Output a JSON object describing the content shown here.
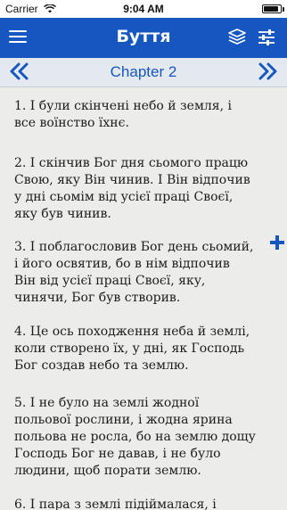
{
  "status_bar": {
    "carrier": "Carrier",
    "time": "9:04 AM",
    "battery_level": 0.9
  },
  "nav_bar": {
    "title": "Буття",
    "menu_icon": "menu-icon",
    "book_icon": "book-icon",
    "settings_icon": "sliders-icon"
  },
  "chapter_bar": {
    "label": "Chapter 2",
    "prev_icon": "double-chevron-left-icon",
    "next_icon": "double-chevron-right-icon"
  },
  "verses": [
    {
      "lines": [
        "1.  І були скінчені небо й земля, і",
        "все воїнство їхнє."
      ]
    },
    {
      "lines": [
        "2.  І скінчив Бог дня сьомого працю",
        "Свою, яку Він чинив. І Він відпочив",
        "у дні сьомім від усієї праці Своєї,",
        "яку був чинив."
      ]
    },
    {
      "lines": [
        "3.  І поблагословив Бог день сьомий,",
        "і його освятив, бо в нім відпочив",
        "Він від усієї праці Своєї, яку,",
        "чинячи, Бог був створив."
      ]
    },
    {
      "lines": [
        "4.  Це ось походження неба й землі,",
        "коли створено їх, у дні, як Господь",
        "Бог создав небо та землю."
      ]
    },
    {
      "lines": [
        "5.  І не було на землі жодної",
        "польової рослини, і жодна ярина",
        "польова не росла, бо на землю дощу",
        "Господь Бог не давав, і не було",
        "людини, щоб порати землю."
      ]
    },
    {
      "lines": [
        "6.  І пара з землі підіймалася, і"
      ]
    }
  ],
  "colors": {
    "nav_blue": "#1656c0",
    "chapter_bar": "#e4e9f0",
    "page_background": "#ececea"
  }
}
